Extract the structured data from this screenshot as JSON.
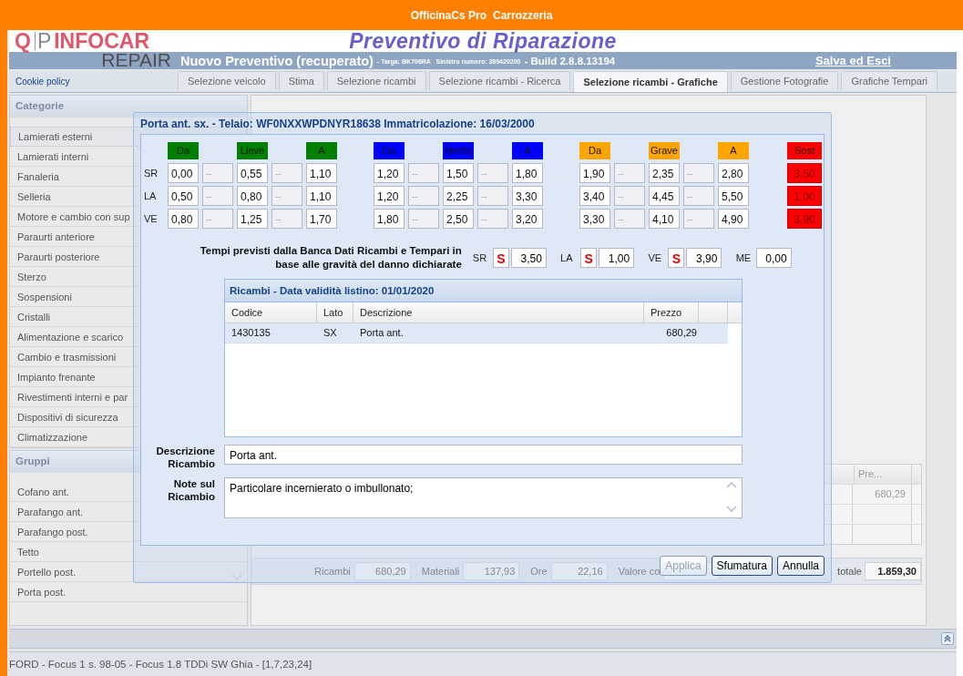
{
  "app_bar": {
    "app": "OfficinaCs Pro",
    "module": "Carrozzeria"
  },
  "logo": {
    "initials": [
      "Q",
      "P"
    ],
    "name": "INFOCAR",
    "tagline": "REPAIR"
  },
  "page_title": "Preventivo di Riparazione",
  "estimate_bar": {
    "title": "Nuovo Preventivo (recuperato)",
    "details": "- Targa: BK706RA   Sinistro numero: 389420200",
    "build": "- Build 2.8.8.13194",
    "save_link": "Salva ed Esci"
  },
  "cookie_link": "Cookie policy",
  "tabs": [
    {
      "label": "Selezione veicolo",
      "selected": false
    },
    {
      "label": "Stima",
      "selected": false
    },
    {
      "label": "Selezione ricambi",
      "selected": false
    },
    {
      "label": "Selezione ricambi - Ricerca",
      "selected": false
    },
    {
      "label": "Selezione ricambi - Grafiche",
      "selected": true
    },
    {
      "label": "Gestione Fotografie",
      "selected": false
    },
    {
      "label": "Grafiche Tempari",
      "selected": false
    }
  ],
  "sidebar": {
    "panels": [
      {
        "title": "Categorie",
        "items": [
          {
            "label": "Lamierati esterni",
            "selected": true
          },
          {
            "label": "Lamierati interni",
            "selected": false
          },
          {
            "label": "Fanaleria",
            "selected": false
          },
          {
            "label": "Selleria",
            "selected": false
          },
          {
            "label": "Motore e cambio con sup",
            "selected": false
          },
          {
            "label": "Paraurti anteriore",
            "selected": false
          },
          {
            "label": "Paraurti posteriore",
            "selected": false
          },
          {
            "label": "Sterzo",
            "selected": false
          },
          {
            "label": "Sospensioni",
            "selected": false
          },
          {
            "label": "Cristalli",
            "selected": false
          },
          {
            "label": "Alimentazione e scarico",
            "selected": false
          },
          {
            "label": "Cambio e trasmissioni",
            "selected": false
          },
          {
            "label": "Impianto frenante",
            "selected": false
          },
          {
            "label": "Rivestimenti interni e par",
            "selected": false
          },
          {
            "label": "Dispositivi di sicurezza",
            "selected": false
          },
          {
            "label": "Climatizzazione",
            "selected": false
          }
        ]
      },
      {
        "title": "Gruppi",
        "items": [
          {
            "label": "Cofano ant.",
            "selected": false
          },
          {
            "label": "Parafango ant.",
            "selected": false
          },
          {
            "label": "Parafango post.",
            "selected": false
          },
          {
            "label": "Tetto",
            "selected": false
          },
          {
            "label": "Portello post.",
            "selected": false
          },
          {
            "label": "Porta post.",
            "selected": false
          }
        ]
      }
    ]
  },
  "background_table": {
    "column": "Pre...",
    "rows": [
      "680,29"
    ]
  },
  "totals": [
    {
      "label": "Ricambi",
      "value": "680,29",
      "kind": "plain"
    },
    {
      "label": "Materiali",
      "value": "137,93",
      "kind": "plain"
    },
    {
      "label": "Ore",
      "value": "22,16",
      "kind": "plain"
    },
    {
      "label": "Valore co",
      "kind": "plain"
    },
    {
      "label": "totale",
      "value": "1.859,30",
      "kind": "total"
    }
  ],
  "dialog": {
    "title": "Porta ant. sx. - Telaio: WF0NXXWPDNYR18638 Immatricolazione: 16/03/2000",
    "grid": {
      "groups": [
        {
          "color": "#008000",
          "headers": [
            "Da",
            "Lieve",
            "A"
          ]
        },
        {
          "color": "#0000ff",
          "headers": [
            "Da",
            "Media",
            "A"
          ]
        },
        {
          "color": "#ffa500",
          "headers": [
            "Da",
            "Grave",
            "A"
          ]
        }
      ],
      "replace": {
        "header": "Sost",
        "color": "#ff0000"
      },
      "rows": [
        {
          "label": "SR",
          "replace": "3,50",
          "groups": [
            [
              {
                "value": "0,00",
                "disabled": false
              },
              {
                "value": "--",
                "disabled": true
              },
              {
                "value": "0,55",
                "disabled": false
              },
              {
                "value": "--",
                "disabled": true
              },
              {
                "value": "1,10",
                "disabled": false
              }
            ],
            [
              {
                "value": "1,20",
                "disabled": false
              },
              {
                "value": "--",
                "disabled": true
              },
              {
                "value": "1,50",
                "disabled": false
              },
              {
                "value": "--",
                "disabled": true
              },
              {
                "value": "1,80",
                "disabled": false
              }
            ],
            [
              {
                "value": "1,90",
                "disabled": false
              },
              {
                "value": "--",
                "disabled": true
              },
              {
                "value": "2,35",
                "disabled": false
              },
              {
                "value": "--",
                "disabled": true
              },
              {
                "value": "2,80",
                "disabled": false
              }
            ]
          ]
        },
        {
          "label": "LA",
          "replace": "1,00",
          "groups": [
            [
              {
                "value": "0,50",
                "disabled": false
              },
              {
                "value": "--",
                "disabled": true
              },
              {
                "value": "0,80",
                "disabled": false
              },
              {
                "value": "--",
                "disabled": true
              },
              {
                "value": "1,10",
                "disabled": false
              }
            ],
            [
              {
                "value": "1,20",
                "disabled": false
              },
              {
                "value": "--",
                "disabled": true
              },
              {
                "value": "2,25",
                "disabled": false
              },
              {
                "value": "--",
                "disabled": true
              },
              {
                "value": "3,30",
                "disabled": false
              }
            ],
            [
              {
                "value": "3,40",
                "disabled": false
              },
              {
                "value": "--",
                "disabled": true
              },
              {
                "value": "4,45",
                "disabled": false
              },
              {
                "value": "--",
                "disabled": true
              },
              {
                "value": "5,50",
                "disabled": false
              }
            ]
          ]
        },
        {
          "label": "VE",
          "replace": "3,90",
          "groups": [
            [
              {
                "value": "0,80",
                "disabled": false
              },
              {
                "value": "--",
                "disabled": true
              },
              {
                "value": "1,25",
                "disabled": false
              },
              {
                "value": "--",
                "disabled": true
              },
              {
                "value": "1,70",
                "disabled": false
              }
            ],
            [
              {
                "value": "1,80",
                "disabled": false
              },
              {
                "value": "--",
                "disabled": true
              },
              {
                "value": "2,50",
                "disabled": false
              },
              {
                "value": "--",
                "disabled": true
              },
              {
                "value": "3,20",
                "disabled": false
              }
            ],
            [
              {
                "value": "3,30",
                "disabled": false
              },
              {
                "value": "--",
                "disabled": true
              },
              {
                "value": "4,10",
                "disabled": false
              },
              {
                "value": "--",
                "disabled": true
              },
              {
                "value": "4,90",
                "disabled": false
              }
            ]
          ]
        }
      ]
    },
    "estimated_times": {
      "caption": "Tempi previsti dalla Banca Dati Ricambi e Tempari in base alle gravità del danno dichiarate",
      "items": [
        {
          "label": "SR",
          "flag": "S",
          "value": "3,50"
        },
        {
          "label": "LA",
          "flag": "S",
          "value": "1,00"
        },
        {
          "label": "VE",
          "flag": "S",
          "value": "3,90"
        },
        {
          "label": "ME",
          "value": "0,00"
        }
      ]
    },
    "parts_table": {
      "title": "Ricambi - Data validità listino: 01/01/2020",
      "columns": [
        "Codice",
        "Lato",
        "Descrizione",
        "Prezzo"
      ],
      "rows": [
        {
          "cells": [
            "1430135",
            "SX",
            "Porta ant.",
            "680,29"
          ],
          "selected": true
        }
      ]
    },
    "description": {
      "label": "Descrizione Ricambio",
      "value": "Porta ant."
    },
    "notes": {
      "label": "Note sul Ricambio",
      "value": "Particolare incernierato o imbullonato;"
    },
    "buttons": [
      {
        "label": "Applica",
        "disabled": true
      },
      {
        "label": "Sfumatura",
        "disabled": false
      },
      {
        "label": "Annulla",
        "disabled": false
      }
    ]
  },
  "status_bar": "FORD - Focus 1 s. 98-05 - Focus 1.8 TDDi SW Ghia - [1,7,23,24]"
}
